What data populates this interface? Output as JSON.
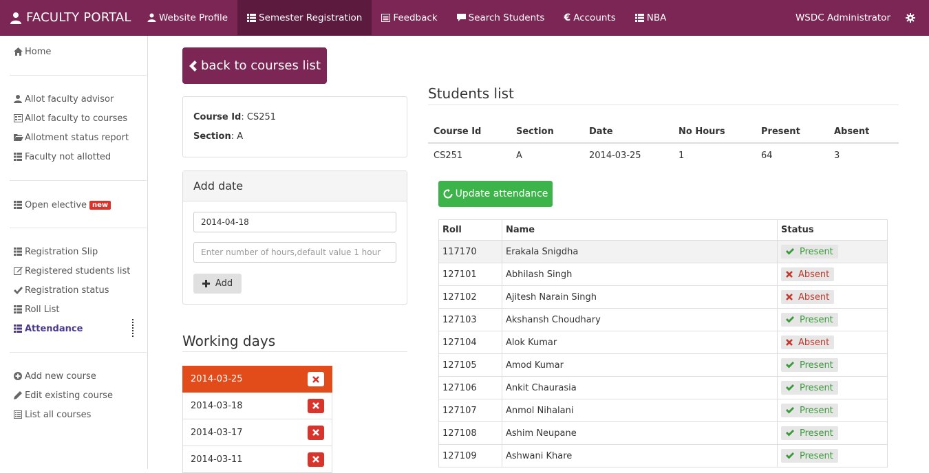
{
  "navbar": {
    "brand": "FACULTY PORTAL",
    "items": [
      {
        "label": "Website Profile",
        "icon": "user-icon"
      },
      {
        "label": "Semester Registration",
        "icon": "list-icon",
        "active": true
      },
      {
        "label": "Feedback",
        "icon": "list-alt-icon"
      },
      {
        "label": "Search Students",
        "icon": "comment-icon"
      },
      {
        "label": "Accounts",
        "icon": "euro-icon"
      },
      {
        "label": "NBA",
        "icon": "list-icon"
      }
    ],
    "user": "WSDC Administrator",
    "settings_icon": "gear-icon"
  },
  "sidebar": {
    "home": "Home",
    "group1": [
      "Allot faculty advisor",
      "Allot faculty to courses",
      "Allotment status report",
      "Faculty not allotted"
    ],
    "open_elective": "Open elective",
    "new_badge": "new",
    "group3": [
      "Registration Slip",
      "Registered students list",
      "Registration status",
      "Roll List",
      "Attendance"
    ],
    "group4": [
      "Add new course",
      "Edit existing course",
      "List all courses"
    ]
  },
  "back_button": "back to courses list",
  "course_info": {
    "course_id_label": "Course Id",
    "course_id": ": CS251",
    "section_label": "Section",
    "section": ": A"
  },
  "add_date": {
    "title": "Add date",
    "date_value": "2014-04-18",
    "hours_placeholder": "Enter number of hours,default value 1 hour",
    "add_button": "Add"
  },
  "working_days": {
    "title": "Working days",
    "dates": [
      "2014-03-25",
      "2014-03-18",
      "2014-03-17",
      "2014-03-11"
    ]
  },
  "students_list": {
    "title": "Students list",
    "summary_headers": [
      "Course Id",
      "Section",
      "Date",
      "No Hours",
      "Present",
      "Absent"
    ],
    "summary_row": [
      "CS251",
      "A",
      "2014-03-25",
      "1",
      "64",
      "3"
    ],
    "update_button": "Update attendance",
    "table_headers": [
      "Roll",
      "Name",
      "Status"
    ],
    "rows": [
      {
        "roll": "117170",
        "name": "Erakala Snigdha",
        "status": "Present"
      },
      {
        "roll": "127101",
        "name": "Abhilash Singh",
        "status": "Absent"
      },
      {
        "roll": "127102",
        "name": "Ajitesh Narain Singh",
        "status": "Absent"
      },
      {
        "roll": "127103",
        "name": "Akshansh Choudhary",
        "status": "Present"
      },
      {
        "roll": "127104",
        "name": "Alok Kumar",
        "status": "Absent"
      },
      {
        "roll": "127105",
        "name": "Amod Kumar",
        "status": "Present"
      },
      {
        "roll": "127106",
        "name": "Ankit Chaurasia",
        "status": "Present"
      },
      {
        "roll": "127107",
        "name": "Anmol Nihalani",
        "status": "Present"
      },
      {
        "roll": "127108",
        "name": "Ashim Neupane",
        "status": "Present"
      },
      {
        "roll": "127109",
        "name": "Ashwani Khare",
        "status": "Present"
      }
    ]
  },
  "colors": {
    "brand": "#7c2655",
    "active_nav": "#5c1a3e",
    "working_day_active": "#e24c1a",
    "update_button": "#3cb44a",
    "delete_button": "#d9342b"
  }
}
